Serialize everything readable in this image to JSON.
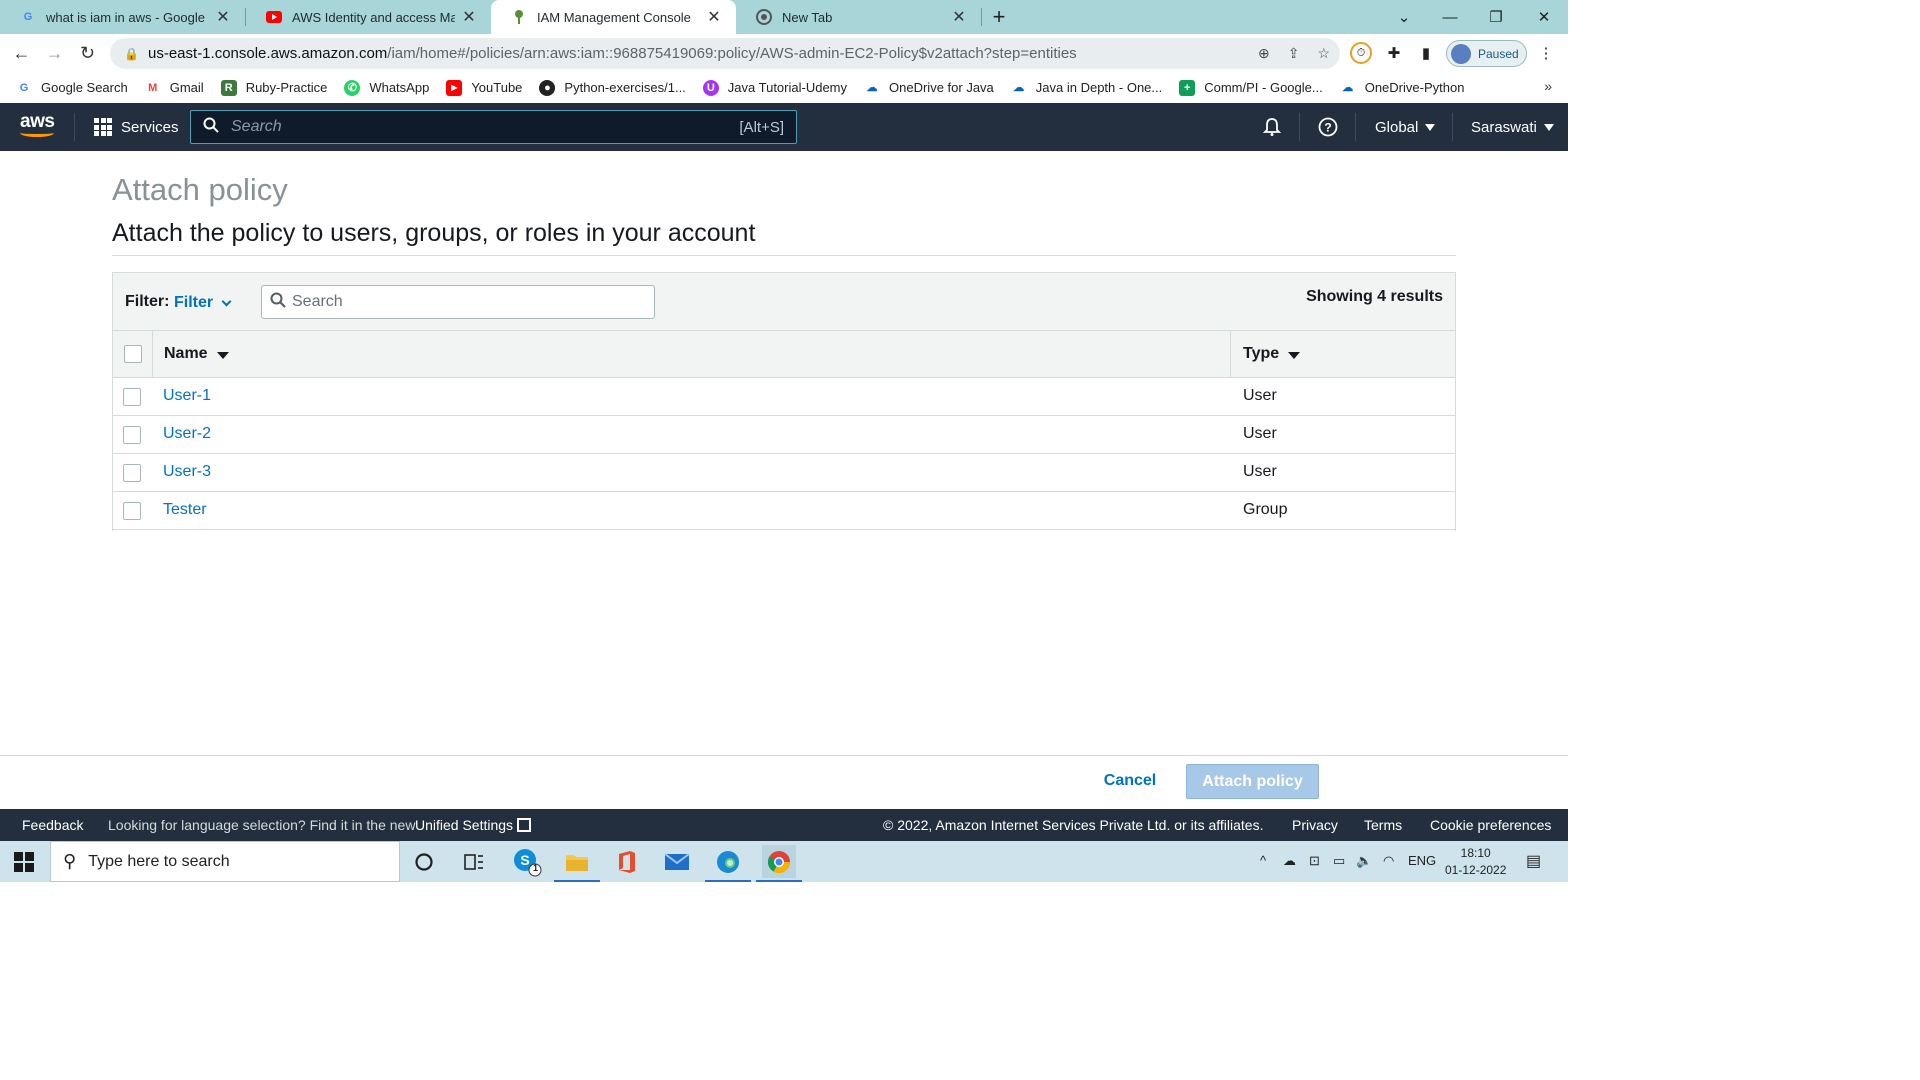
{
  "browser": {
    "tabs": [
      {
        "title": "what is iam in aws - Google Sear",
        "icon": "google-icon"
      },
      {
        "title": "AWS Identity and access Manage",
        "icon": "youtube-icon"
      },
      {
        "title": "IAM Management Console",
        "icon": "aws-iam-icon"
      },
      {
        "title": "New Tab",
        "icon": "chrome-icon"
      }
    ],
    "url_host": "us-east-1.console.aws.amazon.com",
    "url_path": "/iam/home#/policies/arn:aws:iam::968875419069:policy/AWS-admin-EC2-Policy$v2attach?step=entities",
    "profile_status": "Paused",
    "bookmarks": [
      {
        "label": "Google Search",
        "icon": "google-icon",
        "color": "#4285f4"
      },
      {
        "label": "Gmail",
        "icon": "gmail-icon",
        "color": "#ea4335"
      },
      {
        "label": "Ruby-Practice",
        "icon": "sheet-icon",
        "color": "#3b7a3b"
      },
      {
        "label": "WhatsApp",
        "icon": "whatsapp-icon",
        "color": "#25d366"
      },
      {
        "label": "YouTube",
        "icon": "youtube-icon",
        "color": "#ff0000"
      },
      {
        "label": "Python-exercises/1...",
        "icon": "github-icon",
        "color": "#222222"
      },
      {
        "label": "Java Tutorial-Udemy",
        "icon": "udemy-icon",
        "color": "#a435f0"
      },
      {
        "label": "OneDrive for Java",
        "icon": "onedrive-icon",
        "color": "#0364b8"
      },
      {
        "label": "Java in Depth - One...",
        "icon": "onedrive-icon",
        "color": "#0364b8"
      },
      {
        "label": "Comm/PI - Google...",
        "icon": "sheets-plus-icon",
        "color": "#0f9d58"
      },
      {
        "label": "OneDrive-Python",
        "icon": "onedrive-icon",
        "color": "#0364b8"
      }
    ]
  },
  "aws_nav": {
    "logo_text": "aws",
    "services_label": "Services",
    "search_placeholder": "Search",
    "search_shortcut": "[Alt+S]",
    "region_label": "Global",
    "account_label": "Saraswati"
  },
  "page": {
    "title": "Attach policy",
    "subtitle": "Attach the policy to users, groups, or roles in your account"
  },
  "table": {
    "filter_label": "Filter:",
    "filter_value": "Filter",
    "search_placeholder": "Search",
    "results_text": "Showing 4 results",
    "columns": {
      "name": "Name",
      "type": "Type"
    },
    "rows": [
      {
        "name": "User-1",
        "type": "User"
      },
      {
        "name": "User-2",
        "type": "User"
      },
      {
        "name": "User-3",
        "type": "User"
      },
      {
        "name": "Tester",
        "type": "Group"
      }
    ]
  },
  "actions": {
    "cancel_label": "Cancel",
    "attach_label": "Attach policy"
  },
  "footer": {
    "feedback": "Feedback",
    "language_prompt": "Looking for language selection? Find it in the new",
    "unified_settings": "Unified Settings",
    "copyright": "© 2022, Amazon Internet Services Private Ltd. or its affiliates.",
    "privacy": "Privacy",
    "terms": "Terms",
    "cookie": "Cookie preferences"
  },
  "taskbar": {
    "search_placeholder": "Type here to search",
    "language": "ENG",
    "time": "18:10",
    "date": "01-12-2022",
    "skype_badge": "1"
  },
  "colors": {
    "aws_nav_bg": "#232f3e",
    "aws_orange": "#ff9900",
    "link_blue": "#0073bb",
    "disabled_primary": "#a8c8e8",
    "tabstrip_bg": "#a8d5d8"
  }
}
